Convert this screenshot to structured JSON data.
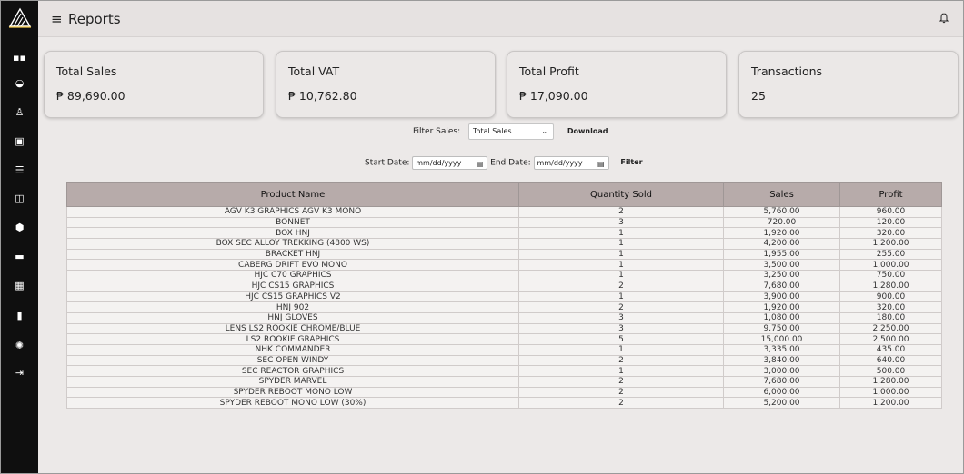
{
  "header": {
    "title": "Reports",
    "menu_icon": "hamburger-icon",
    "bell_icon": "bell-icon"
  },
  "sidebar": {
    "items": [
      {
        "icon": "dashboard-icon",
        "glyph": "▪▪"
      },
      {
        "icon": "shopping-bag-icon",
        "glyph": "◒"
      },
      {
        "icon": "user-icon",
        "glyph": "♙"
      },
      {
        "icon": "stack-icon",
        "glyph": "▣"
      },
      {
        "icon": "list-icon",
        "glyph": "☰"
      },
      {
        "icon": "book-icon",
        "glyph": "◫"
      },
      {
        "icon": "cube-icon",
        "glyph": "⬢"
      },
      {
        "icon": "ticket-icon",
        "glyph": "▬"
      },
      {
        "icon": "calendar-icon",
        "glyph": "▦"
      },
      {
        "icon": "info-icon",
        "glyph": "▮"
      },
      {
        "icon": "settings-icon",
        "glyph": "✺"
      },
      {
        "icon": "logout-icon",
        "glyph": "⇥"
      }
    ]
  },
  "summary": {
    "cards": [
      {
        "label": "Total Sales",
        "value": "₱ 89,690.00"
      },
      {
        "label": "Total VAT",
        "value": "₱ 10,762.80"
      },
      {
        "label": "Total Profit",
        "value": "₱ 17,090.00"
      },
      {
        "label": "Transactions",
        "value": "25"
      }
    ]
  },
  "filters": {
    "filter_sales_label": "Filter Sales:",
    "filter_sales_value": "Total Sales",
    "download_label": "Download",
    "start_date_label": "Start Date:",
    "start_date_value": "mm/dd/yyyy",
    "end_date_label": "End Date:",
    "end_date_value": "mm/dd/yyyy",
    "filter_button": "Filter"
  },
  "table": {
    "columns": [
      "Product Name",
      "Quantity Sold",
      "Sales",
      "Profit"
    ],
    "rows": [
      [
        "AGV K3 GRAPHICS AGV K3 MONO",
        "2",
        "5,760.00",
        "960.00"
      ],
      [
        "BONNET",
        "3",
        "720.00",
        "120.00"
      ],
      [
        "BOX HNJ",
        "1",
        "1,920.00",
        "320.00"
      ],
      [
        "BOX SEC ALLOY TREKKING (4800 WS)",
        "1",
        "4,200.00",
        "1,200.00"
      ],
      [
        "BRACKET HNJ",
        "1",
        "1,955.00",
        "255.00"
      ],
      [
        "CABERG DRIFT EVO MONO",
        "1",
        "3,500.00",
        "1,000.00"
      ],
      [
        "HJC C70 GRAPHICS",
        "1",
        "3,250.00",
        "750.00"
      ],
      [
        "HJC CS15 GRAPHICS",
        "2",
        "7,680.00",
        "1,280.00"
      ],
      [
        "HJC CS15 GRAPHICS V2",
        "1",
        "3,900.00",
        "900.00"
      ],
      [
        "HNJ 902",
        "2",
        "1,920.00",
        "320.00"
      ],
      [
        "HNJ GLOVES",
        "3",
        "1,080.00",
        "180.00"
      ],
      [
        "LENS LS2 ROOKIE CHROME/BLUE",
        "3",
        "9,750.00",
        "2,250.00"
      ],
      [
        "LS2 ROOKIE GRAPHICS",
        "5",
        "15,000.00",
        "2,500.00"
      ],
      [
        "NHK COMMANDER",
        "1",
        "3,335.00",
        "435.00"
      ],
      [
        "SEC OPEN WINDY",
        "2",
        "3,840.00",
        "640.00"
      ],
      [
        "SEC REACTOR GRAPHICS",
        "1",
        "3,000.00",
        "500.00"
      ],
      [
        "SPYDER MARVEL",
        "2",
        "7,680.00",
        "1,280.00"
      ],
      [
        "SPYDER REBOOT MONO LOW",
        "2",
        "6,000.00",
        "1,000.00"
      ],
      [
        "SPYDER REBOOT MONO LOW (30%)",
        "2",
        "5,200.00",
        "1,200.00"
      ]
    ]
  }
}
